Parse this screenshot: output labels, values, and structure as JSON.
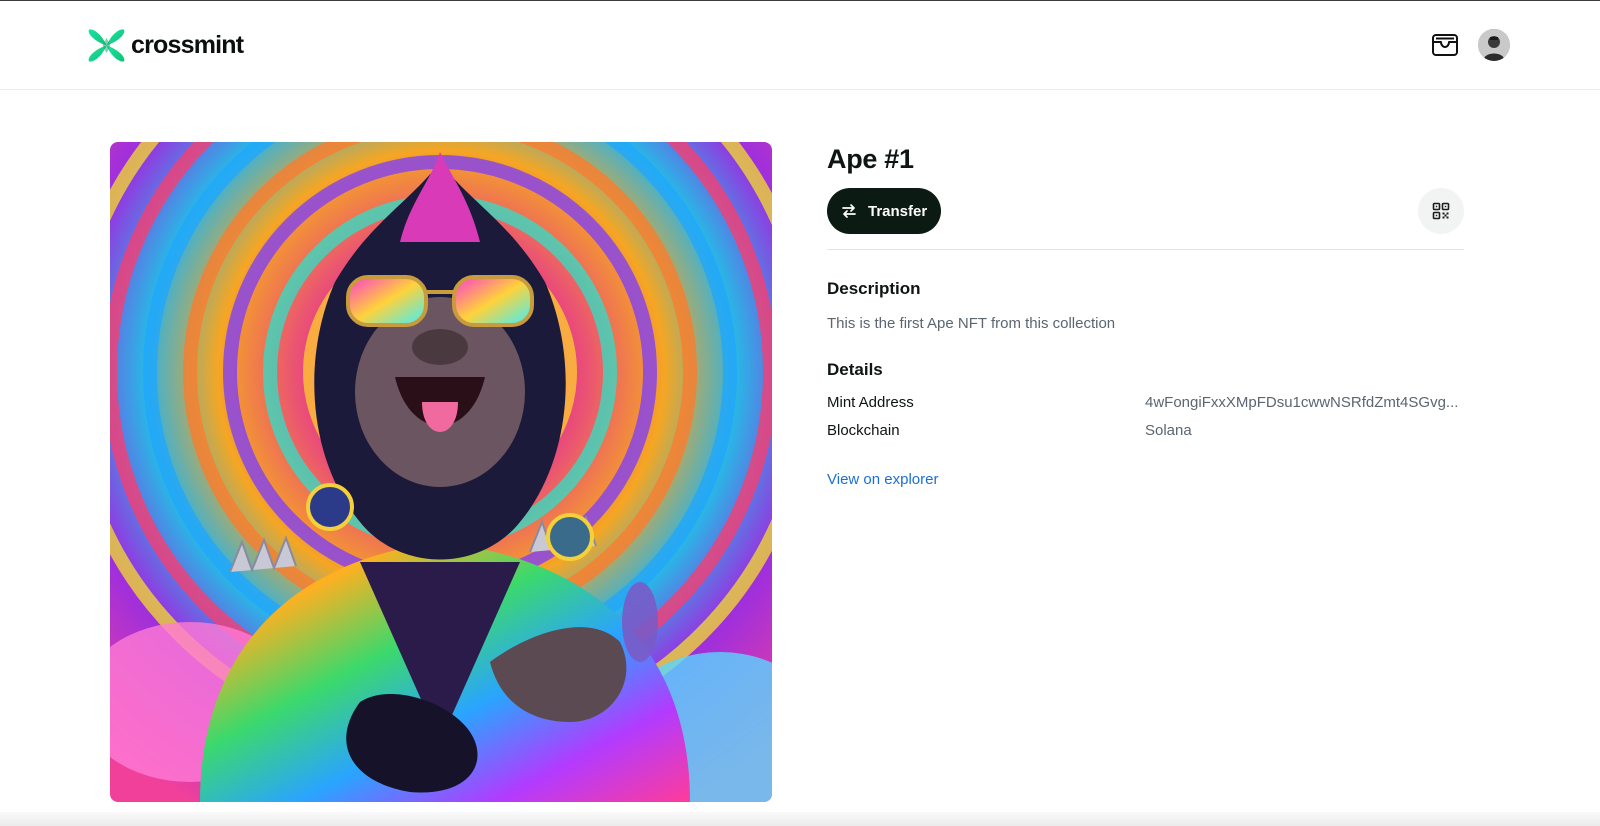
{
  "brand": {
    "name": "crossmint",
    "accent": "#19d98b"
  },
  "header": {
    "wallet_icon": "wallet-icon",
    "avatar": "user-avatar"
  },
  "nft": {
    "title": "Ape #1",
    "image_alt": ""
  },
  "actions": {
    "transfer_label": "Transfer",
    "transfer_icon": "swap-arrows-icon",
    "qr_icon": "qr-code-icon"
  },
  "description": {
    "heading": "Description",
    "text": "This is the first Ape NFT from this collection"
  },
  "details": {
    "heading": "Details",
    "rows": [
      {
        "key": "Mint Address",
        "value": "4wFongiFxxXMpFDsu1cwwNSRfdZmt4SGvg..."
      },
      {
        "key": "Blockchain",
        "value": "Solana"
      }
    ]
  },
  "explorer_link": "View on explorer",
  "colors": {
    "button_dark": "#0b1a12",
    "link": "#1b6fd6",
    "muted_text": "#5b6670"
  }
}
